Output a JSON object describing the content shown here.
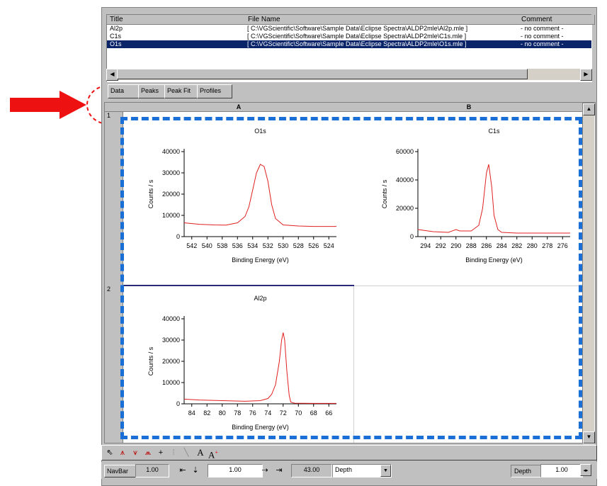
{
  "list": {
    "headers": [
      "Title",
      "File Name",
      "Comment"
    ],
    "rows": [
      {
        "title": "Al2p",
        "file": "[ C:\\VGScientific\\Software\\Sample Data\\Eclipse Spectra\\ALDP2mle\\Al2p.mle ]",
        "comment": "- no comment -"
      },
      {
        "title": "C1s",
        "file": "[ C:\\VGScientific\\Software\\Sample Data\\Eclipse Spectra\\ALDP2mle\\C1s.mle ]",
        "comment": "- no comment -"
      },
      {
        "title": "O1s",
        "file": "[ C:\\VGScientific\\Software\\Sample Data\\Eclipse Spectra\\ALDP2mle\\O1s.mle ]",
        "comment": "- no comment -"
      }
    ]
  },
  "tabs": [
    "Data",
    "Peaks",
    "Peak Fit",
    "Profiles"
  ],
  "grid": {
    "columns": [
      "A",
      "B"
    ],
    "rows": [
      "1",
      "2"
    ]
  },
  "status": {
    "navbar_label": "NavBar",
    "navbar_value": "1.00",
    "step_value": "1.00",
    "position_value": "43.00",
    "mode_select": "Depth",
    "depth_label": "Depth",
    "depth_value": "1.00"
  },
  "chart_data": [
    {
      "type": "line",
      "title": "O1s",
      "xlabel": "Binding Energy (eV)",
      "ylabel": "Counts / s",
      "x_ticks": [
        542,
        540,
        538,
        536,
        534,
        532,
        530,
        528,
        526,
        524
      ],
      "y_ticks": [
        0,
        10000,
        20000,
        30000,
        40000
      ],
      "xlim": [
        543,
        523
      ],
      "ylim": [
        0,
        40000
      ],
      "x_reversed": true,
      "series": [
        {
          "color": "#e02020",
          "x": [
            543,
            541,
            539,
            537.5,
            536,
            535,
            534.5,
            534,
            533.5,
            533,
            532.5,
            532,
            531.5,
            531,
            530,
            528,
            526,
            523
          ],
          "y": [
            6500,
            5800,
            5500,
            5400,
            6500,
            9500,
            14000,
            22000,
            30000,
            34000,
            33000,
            26000,
            15000,
            8500,
            5500,
            5000,
            4800,
            4800
          ]
        }
      ]
    },
    {
      "type": "line",
      "title": "C1s",
      "xlabel": "Binding Energy (eV)",
      "ylabel": "Counts / s",
      "x_ticks": [
        294,
        292,
        290,
        288,
        286,
        284,
        282,
        280,
        278,
        276
      ],
      "y_ticks": [
        0,
        20000,
        40000,
        60000
      ],
      "xlim": [
        295,
        275
      ],
      "ylim": [
        0,
        60000
      ],
      "x_reversed": true,
      "series": [
        {
          "color": "#e02020",
          "x": [
            295,
            293,
            291,
            290,
            289.5,
            288,
            287,
            286.5,
            286,
            285.7,
            285.3,
            285,
            284.5,
            284,
            282,
            280,
            278,
            275
          ],
          "y": [
            5000,
            3500,
            3000,
            5000,
            4000,
            4000,
            8000,
            20000,
            45000,
            51000,
            35000,
            15000,
            5000,
            3000,
            2500,
            2500,
            2500,
            2500
          ]
        }
      ]
    },
    {
      "type": "line",
      "title": "Al2p",
      "xlabel": "Binding Energy (eV)",
      "ylabel": "Counts / s",
      "x_ticks": [
        84,
        82,
        80,
        78,
        76,
        74,
        72,
        70,
        68,
        66
      ],
      "y_ticks": [
        0,
        10000,
        20000,
        30000,
        40000
      ],
      "xlim": [
        85,
        65
      ],
      "ylim": [
        0,
        40000
      ],
      "x_reversed": true,
      "series": [
        {
          "color": "#e02020",
          "x": [
            85,
            83,
            80,
            77,
            75,
            74,
            73.5,
            73,
            72.5,
            72.2,
            72,
            71.8,
            71.5,
            71.2,
            71,
            70.5,
            68,
            65
          ],
          "y": [
            2200,
            1800,
            1500,
            1200,
            1500,
            2500,
            4500,
            9000,
            20000,
            30000,
            33500,
            30000,
            15000,
            4000,
            800,
            300,
            200,
            200
          ]
        }
      ]
    }
  ]
}
